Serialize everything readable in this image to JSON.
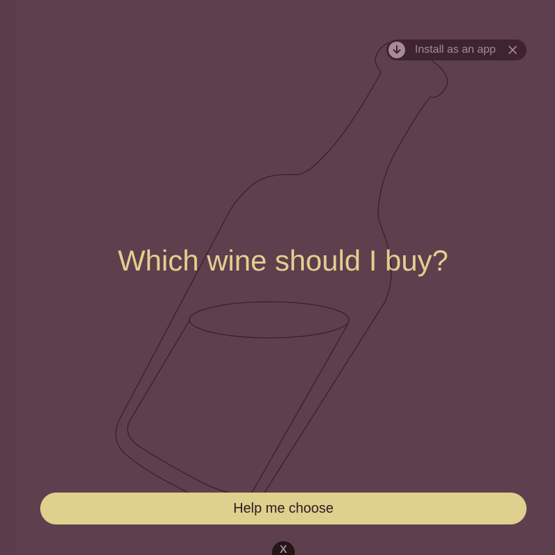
{
  "install_banner": {
    "label": "Install as an app",
    "icon": "download-icon",
    "close_icon": "close-icon"
  },
  "hero": {
    "headline": "Which wine should I buy?",
    "illustration": "wine-bottle-outline"
  },
  "cta": {
    "label": "Help me choose"
  },
  "bottom_badge": {
    "label": "X"
  },
  "colors": {
    "background": "#5e3f4e",
    "headline": "#e6cd8e",
    "button": "#ded08d",
    "outline": "#3a1f2a"
  }
}
